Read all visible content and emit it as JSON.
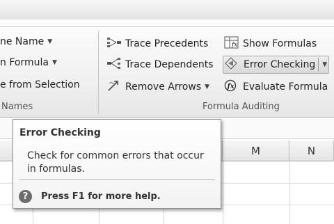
{
  "ribbon": {
    "names_group": {
      "label": "Names",
      "items": [
        {
          "label": "ne Name"
        },
        {
          "label": "n Formula"
        },
        {
          "label": "e from Selection"
        }
      ]
    },
    "formula_auditing": {
      "label": "Formula Auditing",
      "trace_precedents": "Trace Precedents",
      "trace_dependents": "Trace Dependents",
      "remove_arrows": "Remove Arrows",
      "show_formulas": "Show Formulas",
      "error_checking": "Error Checking",
      "evaluate_formula": "Evaluate Formula"
    }
  },
  "grid": {
    "columns": [
      "M",
      "N"
    ]
  },
  "tooltip": {
    "title": "Error Checking",
    "body": "Check for common errors that occur in formulas.",
    "help": "Press F1 for more help."
  }
}
